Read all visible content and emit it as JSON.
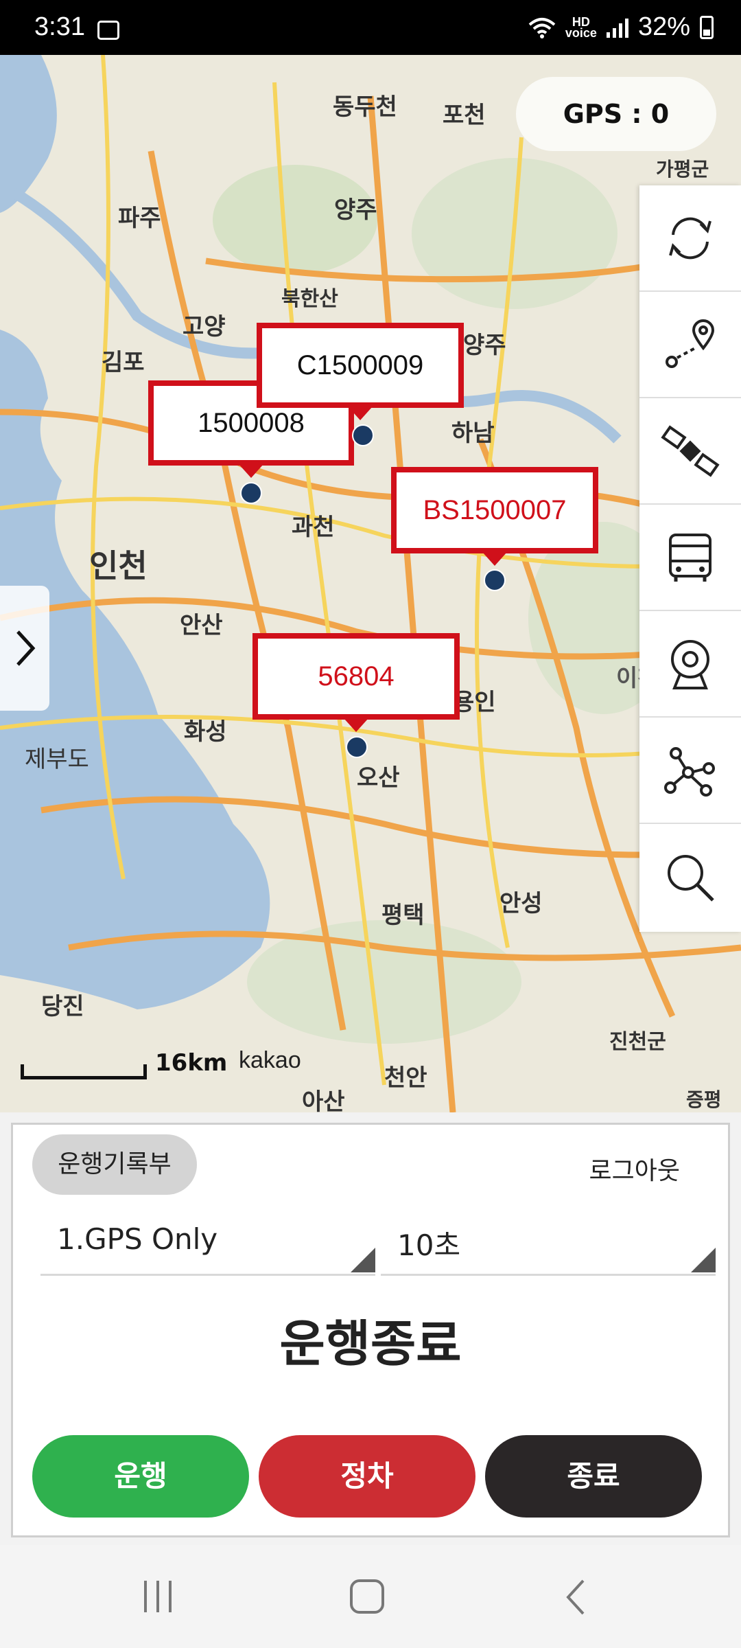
{
  "status_bar": {
    "time": "3:31",
    "hd_label": "HD\nvoice",
    "battery": "32%"
  },
  "map": {
    "place_labels": [
      "동두천",
      "포천",
      "가평군",
      "파주",
      "양주",
      "고양",
      "북한산",
      "김포",
      "양주",
      "하남",
      "인천",
      "과천",
      "안산",
      "화성",
      "제부도",
      "용인",
      "이천",
      "오산",
      "평택",
      "안성",
      "당진",
      "진천군",
      "천안",
      "아산",
      "증평"
    ],
    "gps_label": "GPS : 0",
    "markers": [
      {
        "label": "C1500009",
        "color": "#111111"
      },
      {
        "label": "1500008",
        "color": "#111111"
      },
      {
        "label": "BS1500007",
        "color": "#d0101a"
      },
      {
        "label": "56804",
        "color": "#d0101a"
      }
    ],
    "scale_text": "16km",
    "attribution": "kakao"
  },
  "toolbar": {
    "icons": [
      "refresh-icon",
      "route-icon",
      "satellite-icon",
      "bus-icon",
      "webcam-icon",
      "network-icon",
      "search-icon"
    ]
  },
  "panel": {
    "logbook_label": "운행기록부",
    "logout_label": "로그아웃",
    "mode_select": "1.GPS Only",
    "interval_select": "10초",
    "status_title": "운행종료",
    "buttons": {
      "drive": "운행",
      "stop": "정차",
      "end": "종료"
    }
  },
  "colors": {
    "drive": "#2fb14e",
    "stop": "#cc2d33",
    "end": "#2a2627",
    "marker_border": "#d0101a"
  }
}
